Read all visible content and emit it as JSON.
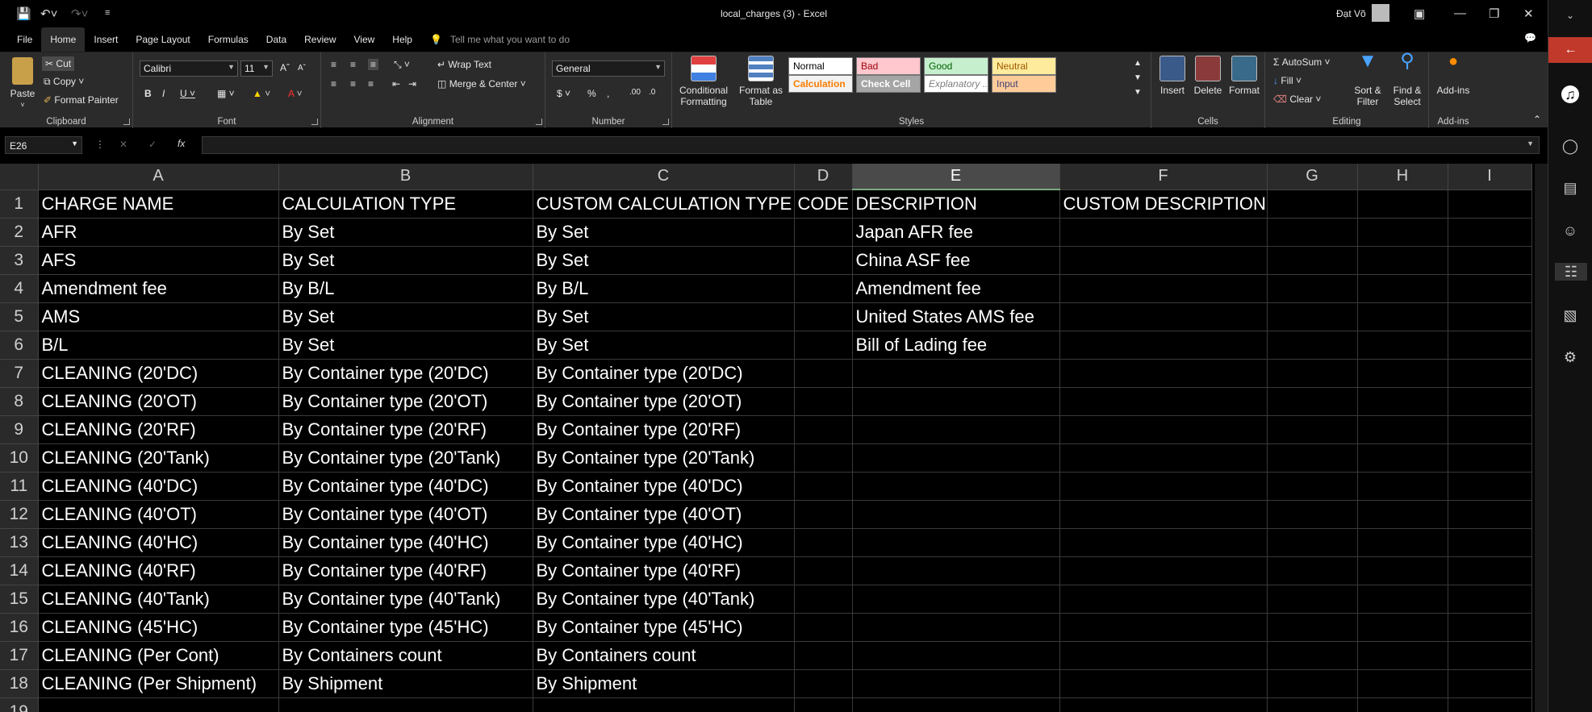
{
  "window": {
    "title": "local_charges (3)  -  Excel",
    "user": "Đạt Võ"
  },
  "tabs": [
    "File",
    "Home",
    "Insert",
    "Page Layout",
    "Formulas",
    "Data",
    "Review",
    "View",
    "Help"
  ],
  "active_tab": "Home",
  "tell_me": "Tell me what you want to do",
  "clipboard": {
    "paste": "Paste",
    "cut": "Cut",
    "copy": "Copy",
    "format_painter": "Format Painter",
    "label": "Clipboard"
  },
  "font": {
    "name": "Calibri",
    "size": "11",
    "label": "Font"
  },
  "alignment": {
    "wrap_text": "Wrap Text",
    "merge_center": "Merge & Center",
    "label": "Alignment"
  },
  "number": {
    "format": "General",
    "label": "Number"
  },
  "styles": {
    "conditional_formatting": "Conditional Formatting",
    "format_as_table": "Format as Table",
    "cells": [
      {
        "name": "Normal",
        "bg": "#ffffff",
        "fg": "#000000"
      },
      {
        "name": "Bad",
        "bg": "#ffc7ce",
        "fg": "#9c0006"
      },
      {
        "name": "Good",
        "bg": "#c6efce",
        "fg": "#006100"
      },
      {
        "name": "Neutral",
        "bg": "#ffeb9c",
        "fg": "#9c5700"
      },
      {
        "name": "Calculation",
        "bg": "#f2f2f2",
        "fg": "#fa7d00"
      },
      {
        "name": "Check Cell",
        "bg": "#a5a5a5",
        "fg": "#ffffff"
      },
      {
        "name": "Explanatory ...",
        "bg": "#ffffff",
        "fg": "#7f7f7f"
      },
      {
        "name": "Input",
        "bg": "#ffcc99",
        "fg": "#3f3f76"
      }
    ],
    "label": "Styles"
  },
  "cells_group": {
    "insert": "Insert",
    "delete": "Delete",
    "format": "Format",
    "label": "Cells"
  },
  "editing": {
    "autosum": "AutoSum",
    "fill": "Fill",
    "clear": "Clear",
    "sort_filter": "Sort & Filter",
    "find_select": "Find & Select",
    "label": "Editing"
  },
  "addins": {
    "button": "Add-ins",
    "label": "Add-ins"
  },
  "name_box": "E26",
  "columns": [
    "A",
    "B",
    "C",
    "D",
    "E",
    "F",
    "G",
    "H",
    "I"
  ],
  "selected_column": "E",
  "rows": [
    [
      "CHARGE NAME",
      "CALCULATION TYPE",
      "CUSTOM CALCULATION TYPE",
      "CODE",
      "DESCRIPTION",
      "CUSTOM DESCRIPTION",
      "",
      "",
      ""
    ],
    [
      "AFR",
      "By Set",
      "By Set",
      "",
      "Japan AFR fee",
      "",
      "",
      "",
      ""
    ],
    [
      "AFS",
      "By Set",
      "By Set",
      "",
      "China ASF fee",
      "",
      "",
      "",
      ""
    ],
    [
      "Amendment fee",
      "By B/L",
      "By B/L",
      "",
      "Amendment fee",
      "",
      "",
      "",
      ""
    ],
    [
      "AMS",
      "By Set",
      "By Set",
      "",
      "United States AMS fee",
      "",
      "",
      "",
      ""
    ],
    [
      "B/L",
      "By Set",
      "By Set",
      "",
      "Bill of Lading fee",
      "",
      "",
      "",
      ""
    ],
    [
      "CLEANING (20'DC)",
      "By Container type (20'DC)",
      "By Container type (20'DC)",
      "",
      "",
      "",
      "",
      "",
      ""
    ],
    [
      "CLEANING (20'OT)",
      "By Container type (20'OT)",
      "By Container type (20'OT)",
      "",
      "",
      "",
      "",
      "",
      ""
    ],
    [
      "CLEANING (20'RF)",
      "By Container type (20'RF)",
      "By Container type (20'RF)",
      "",
      "",
      "",
      "",
      "",
      ""
    ],
    [
      "CLEANING (20'Tank)",
      "By Container type (20'Tank)",
      "By Container type (20'Tank)",
      "",
      "",
      "",
      "",
      "",
      ""
    ],
    [
      "CLEANING (40'DC)",
      "By Container type (40'DC)",
      "By Container type (40'DC)",
      "",
      "",
      "",
      "",
      "",
      ""
    ],
    [
      "CLEANING (40'OT)",
      "By Container type (40'OT)",
      "By Container type (40'OT)",
      "",
      "",
      "",
      "",
      "",
      ""
    ],
    [
      "CLEANING (40'HC)",
      "By Container type (40'HC)",
      "By Container type (40'HC)",
      "",
      "",
      "",
      "",
      "",
      ""
    ],
    [
      "CLEANING (40'RF)",
      "By Container type (40'RF)",
      "By Container type (40'RF)",
      "",
      "",
      "",
      "",
      "",
      ""
    ],
    [
      "CLEANING (40'Tank)",
      "By Container type (40'Tank)",
      "By Container type (40'Tank)",
      "",
      "",
      "",
      "",
      "",
      ""
    ],
    [
      "CLEANING (45'HC)",
      "By Container type (45'HC)",
      "By Container type (45'HC)",
      "",
      "",
      "",
      "",
      "",
      ""
    ],
    [
      "CLEANING (Per Cont)",
      "By Containers count",
      "By Containers count",
      "",
      "",
      "",
      "",
      "",
      ""
    ],
    [
      "CLEANING (Per Shipment)",
      "By Shipment",
      "By Shipment",
      "",
      "",
      "",
      "",
      "",
      ""
    ],
    [
      "",
      "",
      "",
      "",
      "",
      "",
      "",
      "",
      ""
    ]
  ]
}
